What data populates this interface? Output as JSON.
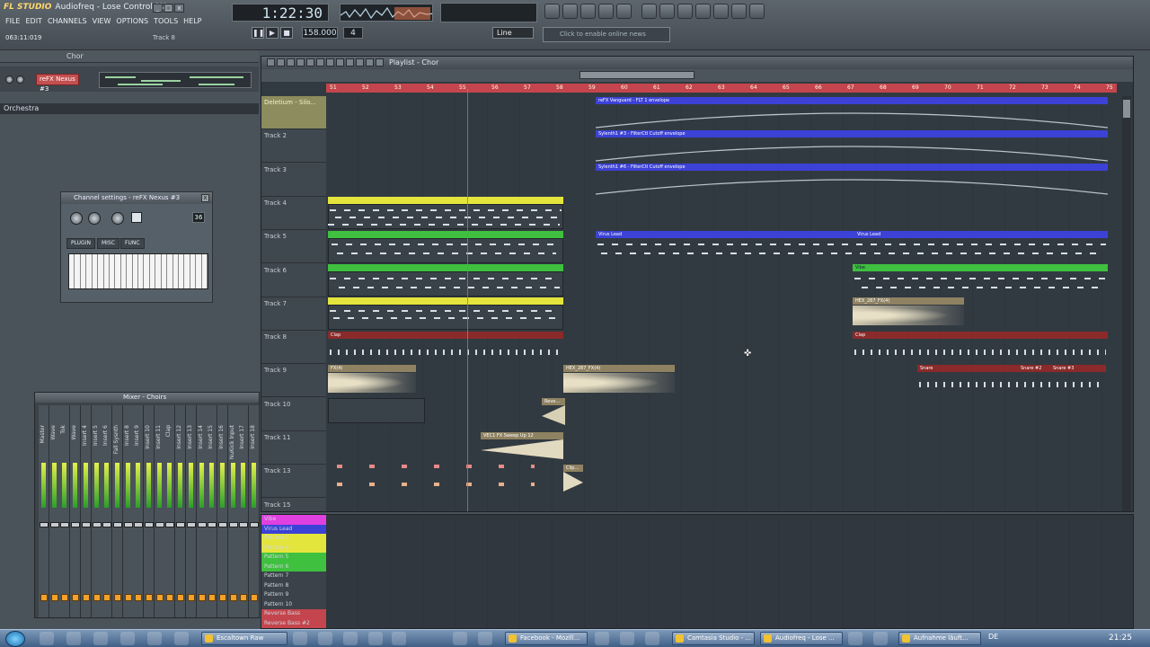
{
  "app": {
    "logo": "FL STUDIO",
    "title": "Audiofreq - Lose Control (AL...",
    "menus": [
      "FILE",
      "EDIT",
      "CHANNELS",
      "VIEW",
      "OPTIONS",
      "TOOLS",
      "HELP"
    ],
    "hint_left": "063:11:019",
    "hint_right": "Track 8"
  },
  "transport": {
    "time": "1:22:30",
    "bpm": "158.000",
    "pattern": "4",
    "play_label": "▶",
    "pause_label": "❚❚",
    "stop_label": "■",
    "rec_label": "●",
    "snap": "Line",
    "news": "Click to enable online news"
  },
  "channel_rack": {
    "title": "Chor",
    "channel_name": "reFX Nexus #3",
    "group": "Orchestra"
  },
  "channel_settings": {
    "title": "Channel settings - reFX Nexus #3",
    "tabs": [
      "PLUGIN",
      "MISC",
      "FUNC"
    ],
    "value_box": "36"
  },
  "mixer": {
    "title": "Mixer - Choirs",
    "tracks": [
      "Master",
      "Wave",
      "Tok",
      "Wave",
      "Insert 4",
      "Insert 5",
      "Insert 6",
      "Fall Sysnth",
      "Insert 8",
      "Insert 9",
      "Insert 10",
      "Insert 11",
      "Clap",
      "Insert 12",
      "Insert 13",
      "Insert 14",
      "Insert 15",
      "Insert 16",
      "NuKick Input",
      "Insert 17",
      "Insert 18"
    ]
  },
  "playlist": {
    "title": "Playlist - Chor",
    "ruler": [
      "51",
      "52",
      "53",
      "54",
      "55",
      "56",
      "57",
      "58",
      "59",
      "60",
      "61",
      "62",
      "63",
      "64",
      "65",
      "66",
      "67",
      "68",
      "69",
      "70",
      "71",
      "72",
      "73",
      "74",
      "75"
    ],
    "tracks": [
      "Deletium - Silo...",
      "Track 2",
      "Track 3",
      "Track 4",
      "Track 5",
      "Track 6",
      "Track 7",
      "Track 8",
      "Track 9",
      "Track 10",
      "Track 11",
      "Track 13",
      "Track 15"
    ],
    "clips": {
      "t1": "reFX Vanguard - FLT 1 envelope",
      "t2": "Sylenth1 #3 - FilterCtl Cutoff envelope",
      "t3": "Sylenth1 #6 - FilterCtl Cutoff envelope",
      "t5a": "Virus Lead",
      "t5b": "Virus Lead",
      "t6": "Vibe",
      "t7": "HEX_287_FX(4)",
      "t8": "Clap",
      "t9a": "FX(4)",
      "t9b": "HEX_287_FX(4)",
      "t9c": "Snare",
      "t9d": "Snare #2",
      "t9e": "Snare #3",
      "t10": "Reve...",
      "t11": "VEC1 FX Sweep Up 12",
      "t13": "Clip..."
    }
  },
  "patterns": [
    "Vibe",
    "Virus Lead",
    "Pattern 3",
    "Pattern 4",
    "Pattern 5",
    "Pattern 6",
    "Pattern 7",
    "Pattern 8",
    "Pattern 9",
    "Pattern 10",
    "Reverse Bass",
    "Reverse Bass #2"
  ],
  "colors": {
    "accent_red": "#c4454d",
    "clip_blue": "#3c42d6",
    "clip_yellow": "#e4e53c",
    "clip_green": "#3fc03f"
  },
  "taskbar": {
    "tasks": [
      "Escaltown Raw",
      "Facebook - Mozill...",
      "Camtasia Studio - ...",
      "Audiofreq - Lose ...",
      "Aufnahme läuft..."
    ],
    "lang": "DE",
    "clock": "21:25"
  }
}
